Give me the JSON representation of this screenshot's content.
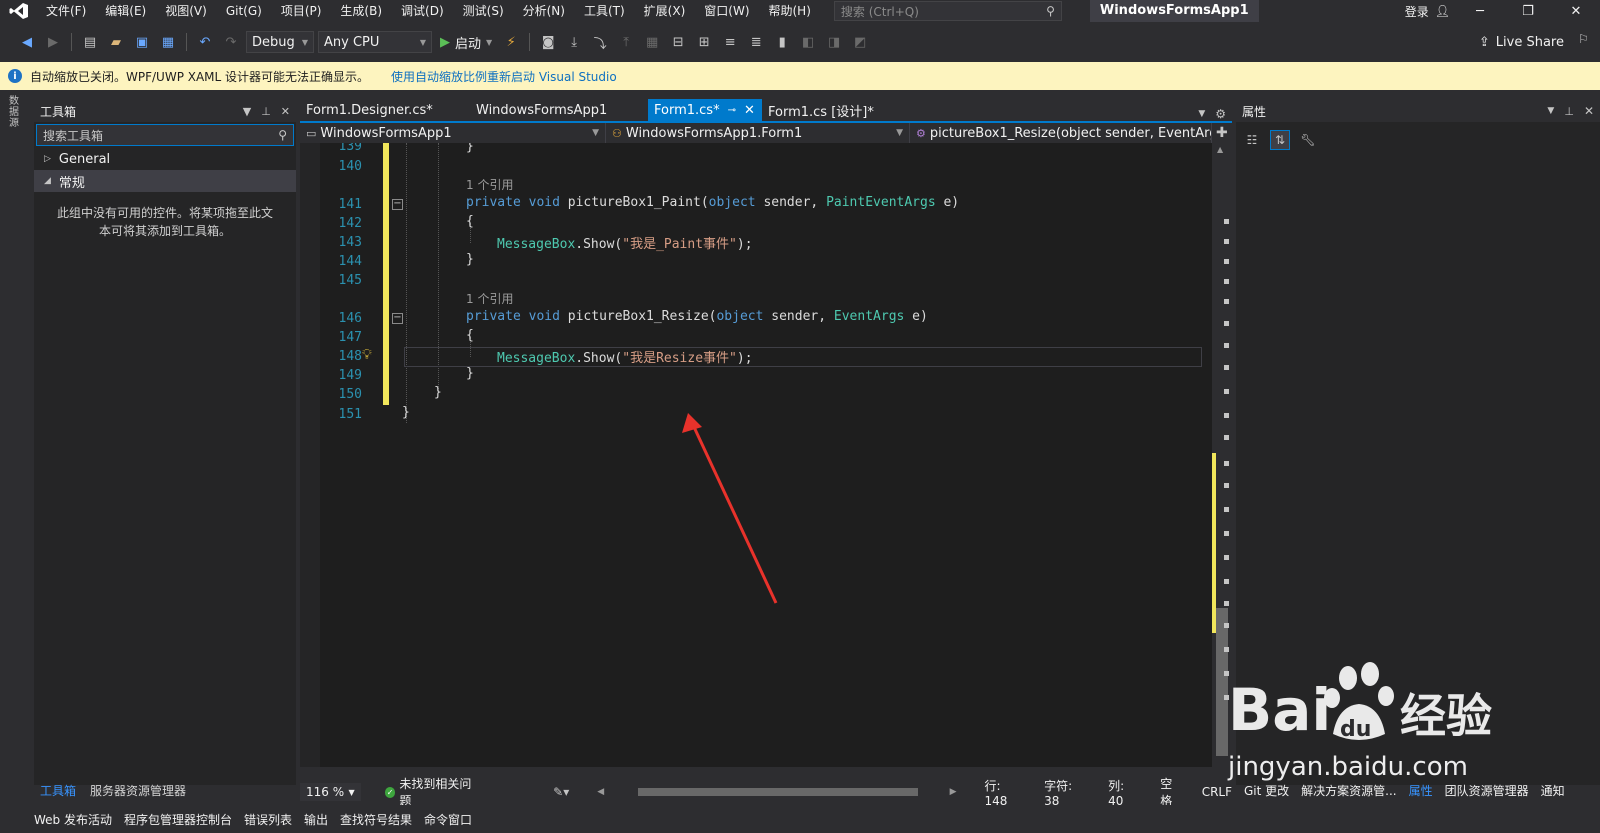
{
  "menubar": {
    "items": [
      "文件(F)",
      "编辑(E)",
      "视图(V)",
      "Git(G)",
      "项目(P)",
      "生成(B)",
      "调试(D)",
      "测试(S)",
      "分析(N)",
      "工具(T)",
      "扩展(X)",
      "窗口(W)",
      "帮助(H)"
    ],
    "search_placeholder": "搜索 (Ctrl+Q)",
    "window_title": "WindowsFormsApp1",
    "login": "登录"
  },
  "toolbar": {
    "config": "Debug",
    "platform": "Any CPU",
    "start": "启动",
    "live_share": "Live Share"
  },
  "infobar": {
    "message": "自动缩放已关闭。WPF/UWP XAML 设计器可能无法正确显示。",
    "link": "使用自动缩放比例重新启动 Visual Studio"
  },
  "left_strip": {
    "label": "数据源"
  },
  "toolbox": {
    "title": "工具箱",
    "search_placeholder": "搜索工具箱",
    "groups": [
      {
        "label": "General",
        "expanded": false
      },
      {
        "label": "常规",
        "expanded": true
      }
    ],
    "empty_message_line1": "此组中没有可用的控件。将某项拖至此文",
    "empty_message_line2": "本可将其添加到工具箱。",
    "footer_tabs": [
      "工具箱",
      "服务器资源管理器"
    ]
  },
  "tabs": [
    {
      "label": "Form1.Designer.cs*",
      "active": false
    },
    {
      "label": "WindowsFormsApp1",
      "active": false
    },
    {
      "label": "Form1.cs*",
      "active": true
    },
    {
      "label": "Form1.cs [设计]*",
      "active": false
    }
  ],
  "navbar": {
    "project": "WindowsFormsApp1",
    "class": "WindowsFormsApp1.Form1",
    "member": "pictureBox1_Resize(object sender, EventArg"
  },
  "editor": {
    "line_numbers": [
      "139",
      "140",
      "141",
      "142",
      "143",
      "144",
      "145",
      "146",
      "147",
      "148",
      "149",
      "150",
      "151"
    ],
    "codelens1": "1 个引用",
    "codelens2": "1 个引用",
    "l139": "}",
    "l141_kw1": "private",
    "l141_kw2": "void",
    "l141_name": "pictureBox1_Paint(",
    "l141_kw3": "object",
    "l141_mid": " sender, ",
    "l141_type": "PaintEventArgs",
    "l141_end": " e)",
    "l142": "{",
    "l143_type": "MessageBox",
    "l143_call": ".Show(",
    "l143_str": "\"我是_Paint事件\"",
    "l143_end": ");",
    "l144": "}",
    "l146_kw1": "private",
    "l146_kw2": "void",
    "l146_name": "pictureBox1_Resize(",
    "l146_kw3": "object",
    "l146_mid": " sender, ",
    "l146_type": "EventArgs",
    "l146_end": " e)",
    "l147": "{",
    "l148_type": "MessageBox",
    "l148_call": ".Show(",
    "l148_str": "\"我是Resize事件\"",
    "l148_end": ");",
    "l149": "}",
    "l150": "}",
    "l151": "}"
  },
  "status": {
    "zoom": "116 %",
    "issues": "未找到相关问题",
    "line": "行: 148",
    "char": "字符: 38",
    "col": "列: 40",
    "spaces": "空格",
    "eol": "CRLF"
  },
  "properties": {
    "title": "属性",
    "footer_tabs": [
      "Git 更改",
      "解决方案资源管...",
      "属性",
      "团队资源管理器",
      "通知"
    ]
  },
  "bottom_bar": {
    "items": [
      "Web 发布活动",
      "程序包管理器控制台",
      "错误列表",
      "输出",
      "查找符号结果",
      "命令窗口"
    ]
  },
  "watermark": {
    "text": "jingyan.baidu.com"
  },
  "colors": {
    "accent": "#007acc",
    "keyword": "#569cd6",
    "type": "#4ec9b0",
    "string": "#d69d85",
    "linenumber": "#2b91af",
    "arrow": "#e8322b"
  }
}
